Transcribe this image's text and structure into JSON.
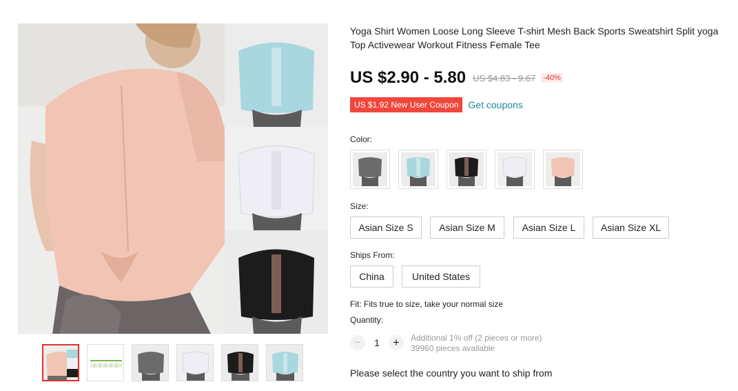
{
  "product": {
    "title": "Yoga Shirt Women Loose Long Sleeve T-shirt Mesh Back Sports Sweatshirt Split yoga Top Activewear Workout Fitness Female Tee",
    "price": "US $2.90 - 5.80",
    "original_price": "US $4.83 - 9.67",
    "discount": "-40%",
    "coupon_label": "US $1.92 New User Coupon",
    "get_coupons_label": "Get coupons"
  },
  "gallery": {
    "thumbnails": [
      {
        "icon": "pink-shirt-thumb",
        "selected": true
      },
      {
        "icon": "size-chart-thumb",
        "selected": false
      },
      {
        "icon": "gray-shirt-thumb",
        "selected": false
      },
      {
        "icon": "white-shirt-thumb",
        "selected": false
      },
      {
        "icon": "black-shirt-thumb",
        "selected": false
      },
      {
        "icon": "blue-shirt-thumb",
        "selected": false
      }
    ],
    "colors": {
      "pink": "#f2c4b3",
      "blue": "#a9d7df",
      "white": "#eeeef4",
      "black": "#1c1c1c",
      "gray": "#6b6b6b",
      "leggings": "#5d5a5c"
    }
  },
  "color": {
    "label": "Color:",
    "swatches": [
      "gray",
      "blue",
      "black",
      "white",
      "pink"
    ]
  },
  "size": {
    "label": "Size:",
    "options": [
      "Asian Size S",
      "Asian Size M",
      "Asian Size L",
      "Asian Size XL"
    ]
  },
  "ships_from": {
    "label": "Ships From:",
    "options": [
      "China",
      "United States"
    ]
  },
  "fit_note": "Fit: Fits true to size, take your normal size",
  "quantity": {
    "label": "Quantity:",
    "value": "1",
    "minus": "−",
    "plus": "+",
    "note_line1": "Additional 1% off (2 pieces or more)",
    "note_line2": "39960 pieces available"
  },
  "ship_message": "Please select the country you want to ship from",
  "theme": {
    "accent": "#e4302a",
    "coupon_bg": "#f0463b",
    "link": "#1a8b9a"
  }
}
